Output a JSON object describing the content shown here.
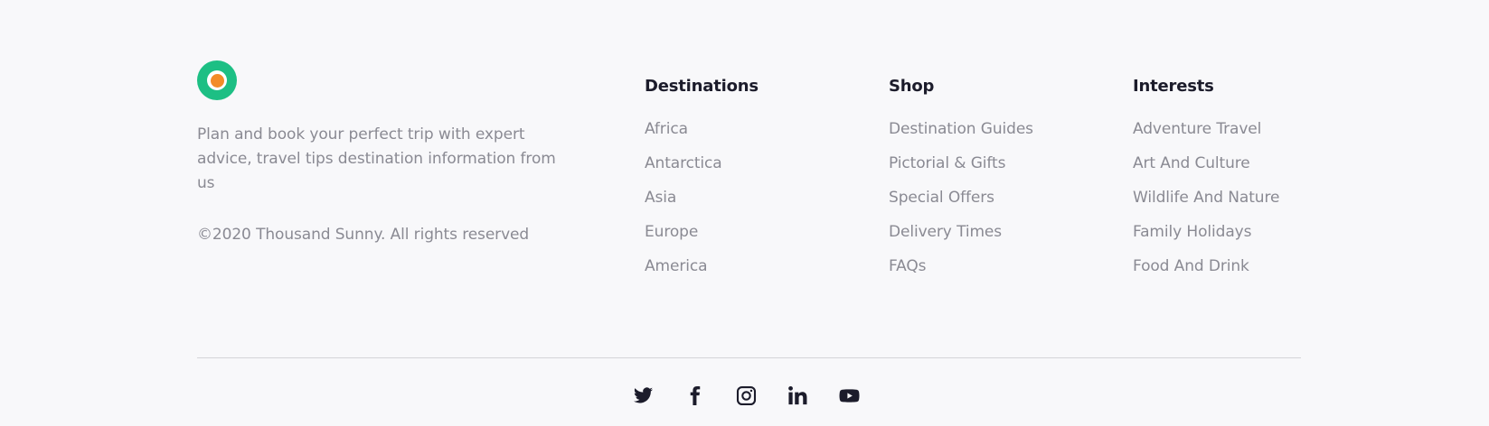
{
  "brand": {
    "logo": "circle-logo",
    "tagline": "Plan and book your perfect trip with expert advice, travel tips destination information from us",
    "copyright": "©2020 Thousand Sunny. All rights reserved"
  },
  "columns": {
    "destinations": {
      "heading": "Destinations",
      "links": [
        "Africa",
        "Antarctica",
        "Asia",
        "Europe",
        "America"
      ]
    },
    "shop": {
      "heading": "Shop",
      "links": [
        "Destination Guides",
        "Pictorial & Gifts",
        "Special Offers",
        "Delivery Times",
        "FAQs"
      ]
    },
    "interests": {
      "heading": "Interests",
      "links": [
        "Adventure Travel",
        "Art And Culture",
        "Wildlife And Nature",
        "Family Holidays",
        "Food And Drink"
      ]
    }
  },
  "social": [
    {
      "icon": "twitter-icon"
    },
    {
      "icon": "facebook-icon"
    },
    {
      "icon": "instagram-icon"
    },
    {
      "icon": "linkedin-icon"
    },
    {
      "icon": "youtube-icon"
    }
  ],
  "colors": {
    "background": "#f8f8fa",
    "logo_green": "#1dbf84",
    "logo_orange": "#f28c28",
    "heading": "#1c1c2b",
    "muted_text": "#8a8a93",
    "divider": "#d4d4d8"
  }
}
